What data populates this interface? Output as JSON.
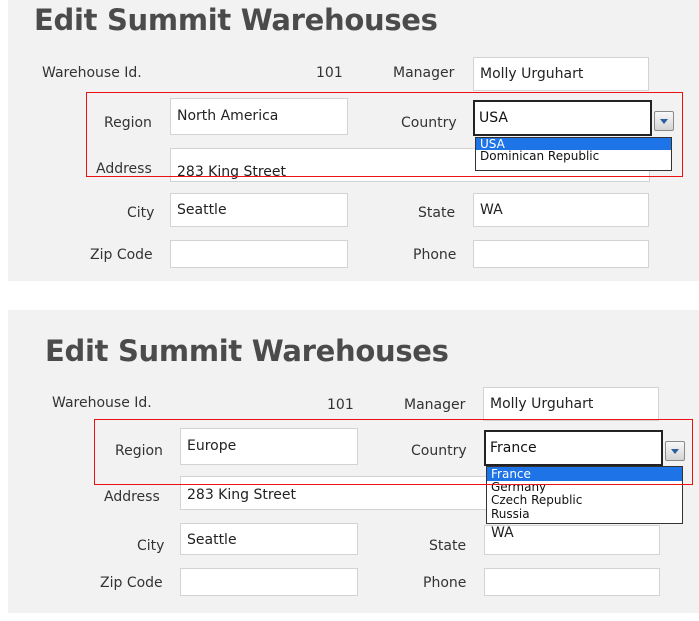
{
  "screen1": {
    "title": "Edit Summit Warehouses",
    "labels": {
      "warehouse_id": "Warehouse Id.",
      "manager": "Manager",
      "region": "Region",
      "country": "Country",
      "address": "Address",
      "city": "City",
      "state": "State",
      "zip_code": "Zip Code",
      "phone": "Phone"
    },
    "values": {
      "warehouse_id": "101",
      "manager": "Molly Urguhart",
      "region": "North America",
      "country": "USA",
      "address": "283 King Street",
      "city": "Seattle",
      "state": "WA",
      "zip_code": "",
      "phone": ""
    },
    "country_options": [
      "USA",
      "Dominican Republic"
    ]
  },
  "screen2": {
    "title": "Edit Summit Warehouses",
    "labels": {
      "warehouse_id": "Warehouse Id.",
      "manager": "Manager",
      "region": "Region",
      "country": "Country",
      "address": "Address",
      "city": "City",
      "state": "State",
      "zip_code": "Zip Code",
      "phone": "Phone"
    },
    "values": {
      "warehouse_id": "101",
      "manager": "Molly Urguhart",
      "region": "Europe",
      "country": "France",
      "address": "283 King Street",
      "city": "Seattle",
      "state": "WA",
      "zip_code": "",
      "phone": ""
    },
    "country_options": [
      "France",
      "Germany",
      "Czech Republic",
      "Russia"
    ]
  },
  "colors": {
    "highlight": "#e11111",
    "selected_option": "#1e74e6",
    "panel": "#f2f2f2"
  }
}
